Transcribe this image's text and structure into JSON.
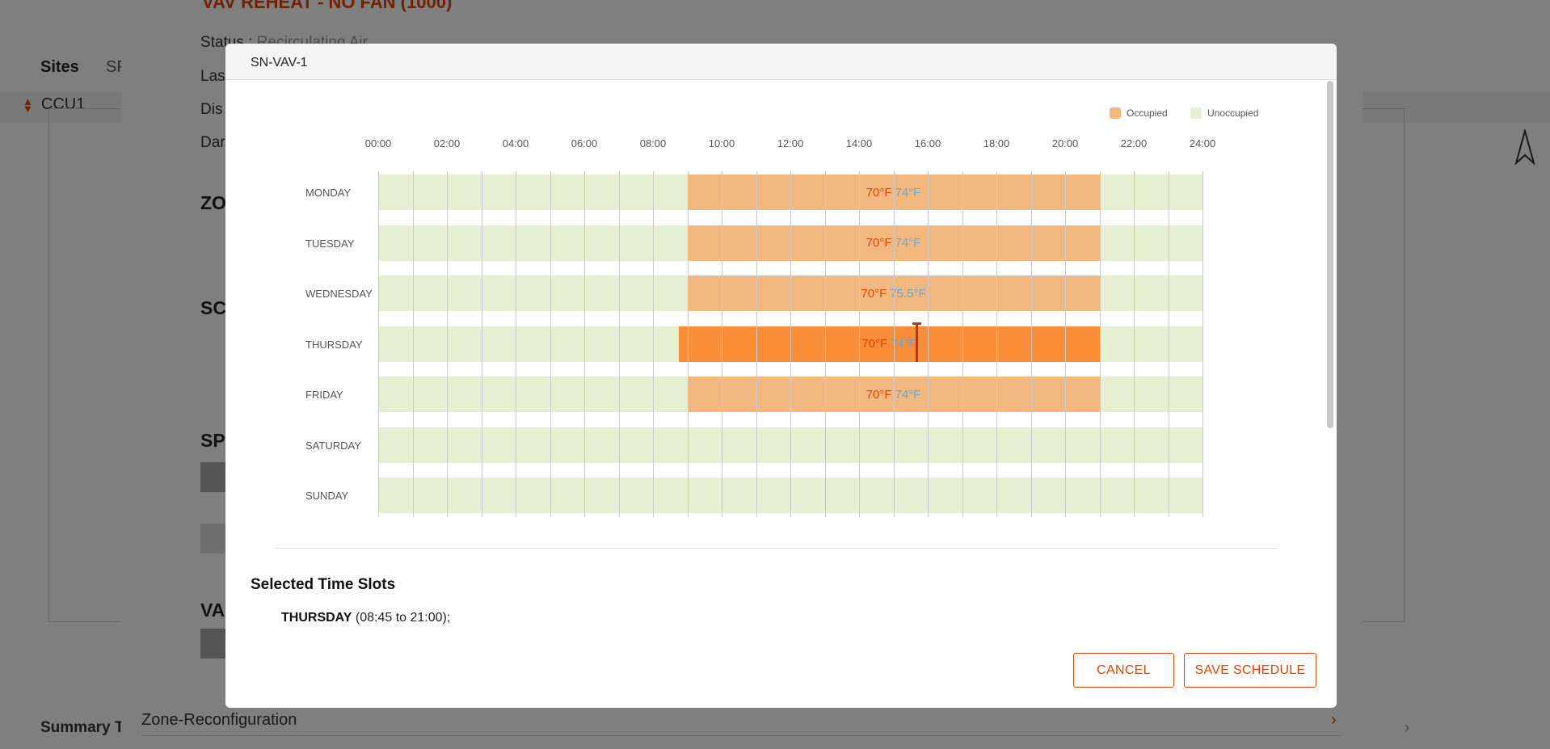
{
  "background": {
    "nav_sites": "Sites",
    "nav_second": "SF",
    "ccu_label": "CCU1",
    "summary_label": "Summary T",
    "compass_glyph": "N"
  },
  "mid_modal": {
    "title": "VAV REHEAT - NO FAN (1000)",
    "rows": [
      {
        "label": "Status : ",
        "value": "Recirculating Air"
      },
      {
        "label": "Las",
        "value": ""
      },
      {
        "label": "Dis",
        "value": ""
      },
      {
        "label": "Dar",
        "value": ""
      }
    ],
    "headings": [
      "ZO",
      "SC",
      "SP",
      "VA"
    ],
    "zone_reconfig": "Zone-Reconfiguration"
  },
  "modal": {
    "title": "SN-VAV-1",
    "legend": [
      {
        "label": "Occupied",
        "color": "#f2b880"
      },
      {
        "label": "Unoccupied",
        "color": "#e6efd2"
      }
    ],
    "time_labels": [
      "00:00",
      "02:00",
      "04:00",
      "06:00",
      "08:00",
      "10:00",
      "12:00",
      "14:00",
      "16:00",
      "18:00",
      "20:00",
      "22:00",
      "24:00"
    ],
    "days": [
      {
        "name": "MONDAY",
        "start": 9.0,
        "end": 21.0,
        "heat": "70°F",
        "cool": "74°F",
        "selected": false
      },
      {
        "name": "TUESDAY",
        "start": 9.0,
        "end": 21.0,
        "heat": "70°F",
        "cool": "74°F",
        "selected": false
      },
      {
        "name": "WEDNESDAY",
        "start": 9.0,
        "end": 21.0,
        "heat": "70°F",
        "cool": "75.5°F",
        "selected": false
      },
      {
        "name": "THURSDAY",
        "start": 8.75,
        "end": 21.0,
        "heat": "70°F",
        "cool": "74°F",
        "selected": true
      },
      {
        "name": "FRIDAY",
        "start": 9.0,
        "end": 21.0,
        "heat": "70°F",
        "cool": "74°F",
        "selected": false
      },
      {
        "name": "SATURDAY",
        "start": null,
        "end": null,
        "heat": "",
        "cool": "",
        "selected": false
      },
      {
        "name": "SUNDAY",
        "start": null,
        "end": null,
        "heat": "",
        "cool": "",
        "selected": false
      }
    ],
    "current_time_hours": 15.65,
    "selected_heading": "Selected Time Slots",
    "selected_slots": [
      {
        "day": "THURSDAY",
        "range": "(08:45 to 21:00);"
      }
    ],
    "cancel_label": "CANCEL",
    "save_label": "SAVE SCHEDULE"
  },
  "colors": {
    "accent": "#e24301",
    "occupied": "#f2b880",
    "occupied_selected": "#f98d38",
    "unoccupied": "#e6efd2",
    "heat_text": "#e24301",
    "cool_text": "#5fa9dd"
  }
}
